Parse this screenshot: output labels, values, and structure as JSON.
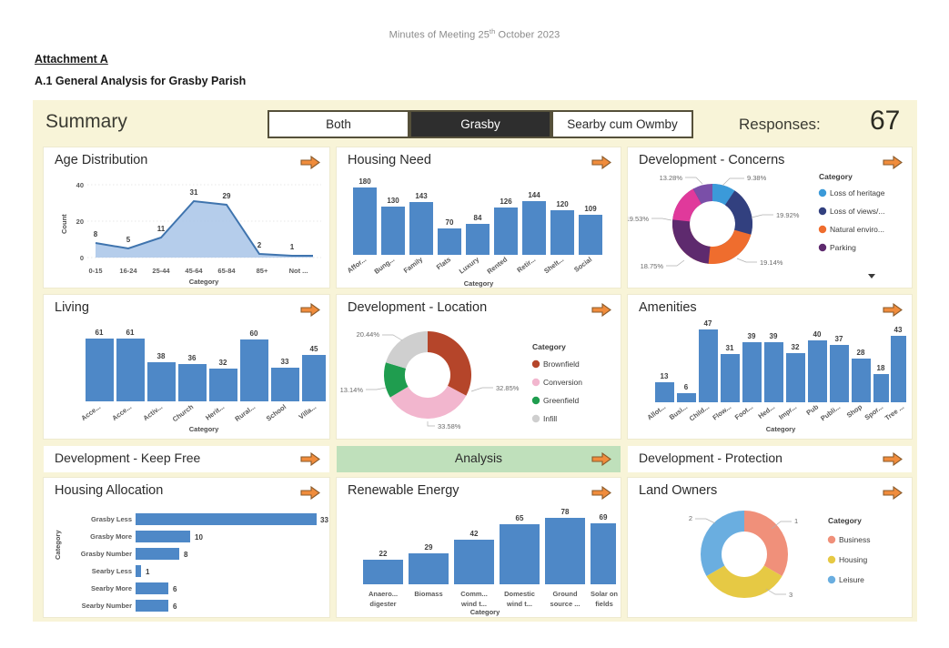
{
  "document": {
    "running_head": "Minutes of Meeting 25",
    "running_head_sup": "th",
    "running_head_rest": " October 2023",
    "attachment": "Attachment A",
    "subtitle": "A.1 General Analysis for Grasby Parish"
  },
  "summary": {
    "title": "Summary",
    "slicers": [
      {
        "label": "Both",
        "selected": false
      },
      {
        "label": "Grasby",
        "selected": true
      },
      {
        "label": "Searby cum Owmby",
        "selected": false
      }
    ],
    "responses_label": "Responses:",
    "responses_value": "67"
  },
  "bands": [
    {
      "title": "Development - Keep Free",
      "highlight": false
    },
    {
      "title": "Analysis",
      "highlight": true
    },
    {
      "title": "Development - Protection",
      "highlight": false
    }
  ],
  "colors": {
    "page_bg": "#f8f4d8",
    "card_bg": "#ffffff",
    "bar_blue": "#4e88c7",
    "area_fill": "#a8c4e8",
    "area_line": "#3f74ae",
    "band_green": "#bfe0bb",
    "arrow_orange": "#f08c3c",
    "slicer_selected_bg": "#2e2e2e"
  },
  "chart_data": [
    {
      "id": "age-distribution",
      "type": "area",
      "title": "Age Distribution",
      "xlabel": "Category",
      "ylabel": "Count",
      "categories": [
        "0-15",
        "16-24",
        "25-44",
        "45-64",
        "65-84",
        "85+",
        "Not ..."
      ],
      "values": [
        8,
        5,
        11,
        31,
        29,
        2,
        1
      ],
      "yticks": [
        0,
        20,
        40
      ],
      "ylim": [
        0,
        40
      ],
      "grid": true
    },
    {
      "id": "housing-need",
      "type": "bar",
      "title": "Housing Need",
      "xlabel": "Category",
      "ylabel": "",
      "categories": [
        "Affor...",
        "Bung...",
        "Family",
        "Flats",
        "Luxury",
        "Rented",
        "Retir...",
        "Shelt...",
        "Social"
      ],
      "values": [
        180,
        130,
        143,
        70,
        84,
        126,
        144,
        120,
        109
      ],
      "ylim": [
        0,
        200
      ],
      "grid": false
    },
    {
      "id": "development-concerns",
      "type": "pie",
      "title": "Development - Concerns",
      "legend_title": "Category",
      "legend_position": "right",
      "legend_truncated": true,
      "labels": [
        "Loss of heritage",
        "Loss of views/...",
        "Natural enviro...",
        "Parking"
      ],
      "slice_percents": [
        "9.38%",
        "19.92%",
        "19.14%",
        "18.75%",
        "19.53%",
        "13.28%"
      ],
      "values": [
        9.38,
        19.92,
        19.14,
        18.75,
        19.53,
        13.28
      ],
      "slice_colors": [
        "#3b9ad9",
        "#32407f",
        "#ef6d2e",
        "#5e2a6e",
        "#e0399b",
        "#7a4fa8"
      ],
      "legend_colors": [
        "#3b9ad9",
        "#32407f",
        "#ef6d2e",
        "#5e2a6e"
      ]
    },
    {
      "id": "living",
      "type": "bar",
      "title": "Living",
      "xlabel": "Category",
      "ylabel": "",
      "categories": [
        "Acce...",
        "Acce...",
        "Activ...",
        "Church",
        "Herit...",
        "Rural...",
        "School",
        "Villa..."
      ],
      "values": [
        61,
        61,
        38,
        36,
        32,
        60,
        33,
        45
      ],
      "ylim": [
        0,
        70
      ],
      "grid": false
    },
    {
      "id": "development-location",
      "type": "pie",
      "title": "Development - Location",
      "legend_title": "Category",
      "legend_position": "right",
      "labels": [
        "Brownfield",
        "Conversion",
        "Greenfield",
        "Infill"
      ],
      "slice_percents": [
        "32.85%",
        "33.58%",
        "13.14%",
        "20.44%"
      ],
      "values": [
        32.85,
        33.58,
        13.14,
        20.44
      ],
      "slice_colors": [
        "#b5452a",
        "#f2b6ce",
        "#1f9d4f",
        "#cfcfcf"
      ]
    },
    {
      "id": "amenities",
      "type": "bar",
      "title": "Amenities",
      "xlabel": "Category",
      "ylabel": "",
      "categories": [
        "Allot...",
        "Busi...",
        "Child...",
        "Flow...",
        "Foot...",
        "Hed...",
        "Impr...",
        "Pub",
        "Publi...",
        "Shop",
        "Spor...",
        "Tree ..."
      ],
      "values": [
        13,
        6,
        47,
        31,
        39,
        39,
        32,
        40,
        37,
        28,
        18,
        43
      ],
      "ylim": [
        0,
        50
      ],
      "grid": false
    },
    {
      "id": "housing-allocation",
      "type": "bar",
      "orientation": "horizontal",
      "title": "Housing Allocation",
      "xlabel": "",
      "ylabel": "Category",
      "categories": [
        "Grasby Less",
        "Grasby More",
        "Grasby Number",
        "Searby Less",
        "Searby More",
        "Searby Number"
      ],
      "values": [
        33,
        10,
        8,
        1,
        6,
        6
      ],
      "xlim": [
        0,
        35
      ],
      "grid": false
    },
    {
      "id": "renewable-energy",
      "type": "bar",
      "title": "Renewable Energy",
      "xlabel": "Category",
      "ylabel": "",
      "categories": [
        "Anaero... digester",
        "Biomass",
        "Comm... wind t...",
        "Domestic wind t...",
        "Ground source ...",
        "Solar on fields"
      ],
      "values": [
        22,
        29,
        42,
        65,
        78,
        69
      ],
      "ylim": [
        0,
        85
      ],
      "grid": false
    },
    {
      "id": "land-owners",
      "type": "pie",
      "title": "Land Owners",
      "legend_title": "Category",
      "legend_position": "right",
      "labels": [
        "Business",
        "Housing",
        "Leisure"
      ],
      "slice_labels": [
        "1",
        "3",
        "2"
      ],
      "values": [
        1,
        3,
        2
      ],
      "slice_colors": [
        "#f0907a",
        "#e6c944",
        "#6aaee0"
      ]
    }
  ]
}
